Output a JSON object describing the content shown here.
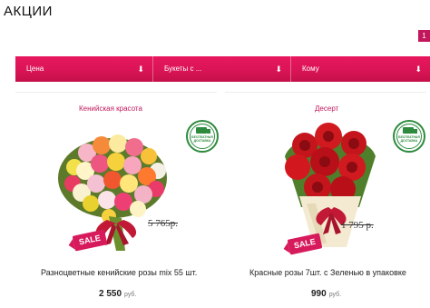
{
  "page": {
    "title": "АКЦИИ",
    "badge": "1"
  },
  "filters": [
    {
      "label": "Цена",
      "arrow": "⬇"
    },
    {
      "label": "Букеты с ...",
      "arrow": "⬇"
    },
    {
      "label": "Кому",
      "arrow": "⬇"
    }
  ],
  "products": [
    {
      "name": "Кенийская красота",
      "old_price": "5 765р.",
      "sale": "SALE",
      "shipping_badge": "БЕСПЛАТНАЯ ДОСТАВКА",
      "title": "Разноцветные кенийские розы mix 55 шт.",
      "price": "2 550",
      "currency": "руб."
    },
    {
      "name": "Десерт",
      "old_price": "1 795 р.",
      "sale": "SALE",
      "shipping_badge": "БЕСПЛАТНАЯ ДОСТАВКА",
      "title": "Красные розы 7шт. с Зеленью в упаковке",
      "price": "990",
      "currency": "руб."
    }
  ],
  "colors": {
    "accent": "#d81455",
    "name_link": "#c2185b",
    "shipping_green": "#2e8b3e"
  }
}
